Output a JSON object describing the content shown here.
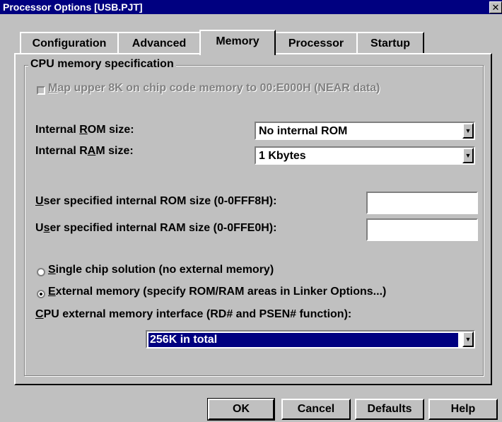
{
  "window": {
    "title": "Processor Options [USB.PJT]",
    "close_glyph": "✕"
  },
  "tabs": [
    {
      "label": "Configuration",
      "active": false
    },
    {
      "label": "Advanced",
      "active": false
    },
    {
      "label": "Memory",
      "active": true
    },
    {
      "label": "Processor",
      "active": false
    },
    {
      "label": "Startup",
      "active": false
    }
  ],
  "group": {
    "label": "CPU memory specification"
  },
  "map_upper": {
    "label_pre": "",
    "label_u": "M",
    "label_post": "ap upper 8K on chip code memory to 00:E000H (NEAR data)",
    "checked": false,
    "enabled": false
  },
  "internal_rom": {
    "label_pre": "Internal ",
    "label_u": "R",
    "label_post": "OM size:",
    "value": "No internal ROM"
  },
  "internal_ram": {
    "label_pre": "Internal R",
    "label_u": "A",
    "label_post": "M size:",
    "value": "1 Kbytes"
  },
  "user_rom": {
    "label_pre": "",
    "label_u": "U",
    "label_post": "ser specified internal ROM size (0-0FFF8H):",
    "value": ""
  },
  "user_ram": {
    "label_pre": "U",
    "label_u": "s",
    "label_post": "er specified internal RAM size (0-0FFE0H):",
    "value": ""
  },
  "radio_single": {
    "label_pre": "",
    "label_u": "S",
    "label_post": "ingle chip solution (no external memory)",
    "selected": false
  },
  "radio_external": {
    "label_pre": "",
    "label_u": "E",
    "label_post": "xternal memory (specify ROM/RAM areas in Linker Options...)",
    "selected": true
  },
  "ext_interface": {
    "label_pre": "",
    "label_u": "C",
    "label_post": "PU external memory interface (RD# and PSEN# function):",
    "value": "256K in total"
  },
  "buttons": {
    "ok": "OK",
    "cancel": "Cancel",
    "defaults": "Defaults",
    "help": "Help"
  },
  "icons": {
    "dropdown_arrow": "▼"
  }
}
